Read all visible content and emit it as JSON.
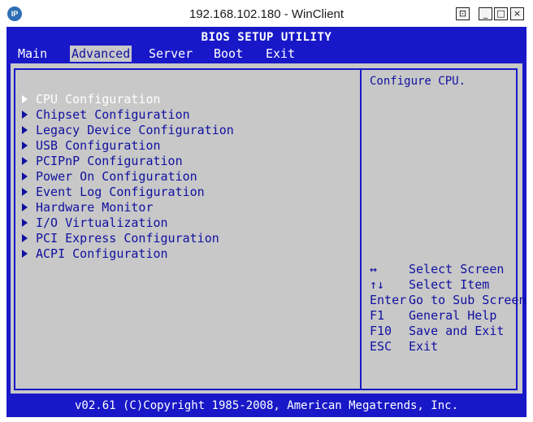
{
  "window": {
    "title": "192.168.102.180 - WinClient",
    "icon_label": "IP",
    "controls": {
      "pin": "⊡",
      "minimize": "_",
      "maximize": "□",
      "close": "×"
    }
  },
  "bios": {
    "title": "BIOS SETUP UTILITY",
    "menu": [
      {
        "label": "Main",
        "active": false
      },
      {
        "label": "Advanced",
        "active": true
      },
      {
        "label": "Server",
        "active": false
      },
      {
        "label": "Boot",
        "active": false
      },
      {
        "label": "Exit",
        "active": false
      }
    ],
    "items": [
      {
        "label": "CPU Configuration",
        "selected": true
      },
      {
        "label": "Chipset Configuration"
      },
      {
        "label": "Legacy Device Configuration"
      },
      {
        "label": "USB Configuration"
      },
      {
        "label": "PCIPnP Configuration"
      },
      {
        "label": "Power On Configuration"
      },
      {
        "label": "Event Log Configuration"
      },
      {
        "label": "Hardware Monitor"
      },
      {
        "label": "I/O Virtualization"
      },
      {
        "label": "PCI Express Configuration"
      },
      {
        "label": "ACPI Configuration"
      }
    ],
    "help_text": "Configure CPU.",
    "keys": [
      {
        "key": "↔",
        "action": "Select Screen"
      },
      {
        "key": "↑↓",
        "action": "Select Item"
      },
      {
        "key": "Enter",
        "action": "Go to Sub Screen"
      },
      {
        "key": "F1",
        "action": "General Help"
      },
      {
        "key": "F10",
        "action": "Save and Exit"
      },
      {
        "key": "ESC",
        "action": "Exit"
      }
    ],
    "footer": "v02.61 (C)Copyright 1985-2008, American Megatrends, Inc.",
    "colors": {
      "background": "#1818c8",
      "panel": "#c8c8c8",
      "text": "#1010a0",
      "highlight": "#ffffff"
    }
  }
}
